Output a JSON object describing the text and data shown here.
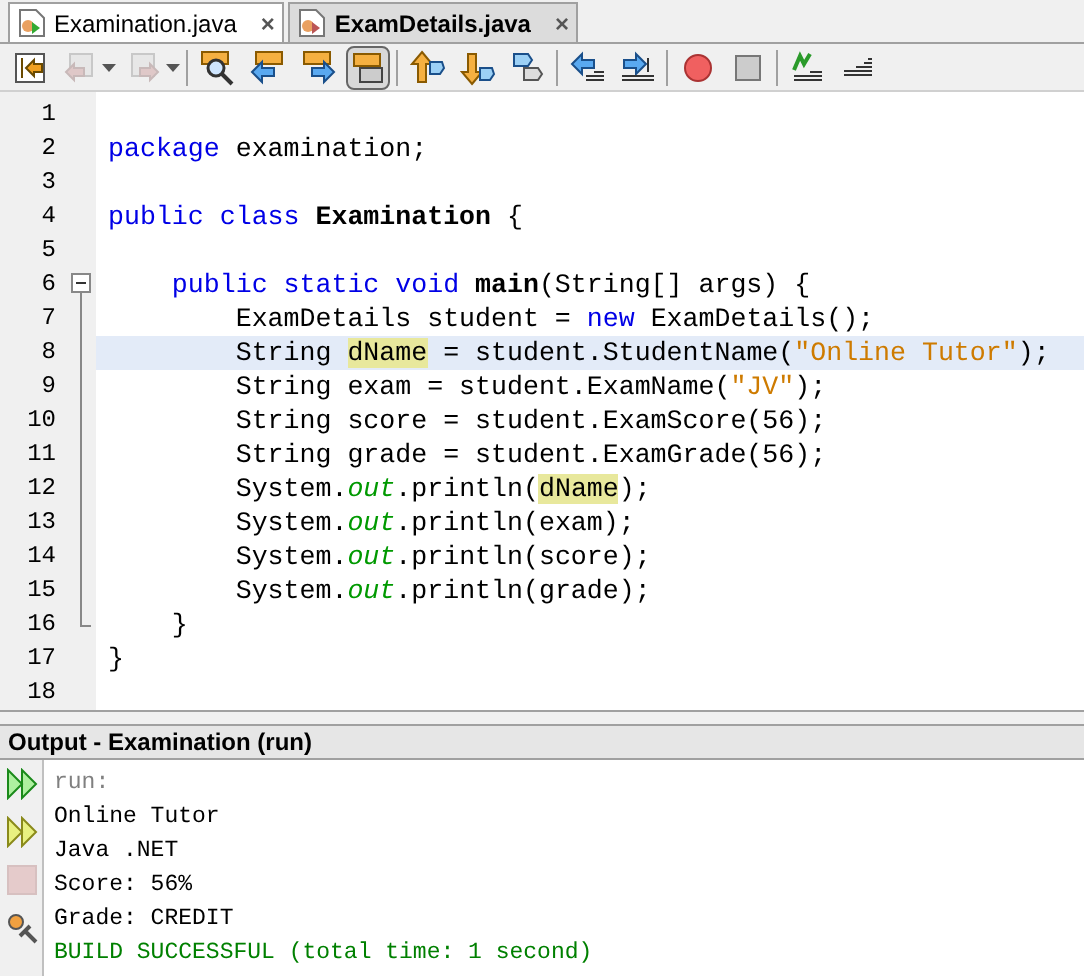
{
  "tabs": [
    {
      "label": "Examination.java",
      "selected": true,
      "modified": false,
      "close": "×"
    },
    {
      "label": "ExamDetails.java",
      "selected": false,
      "modified": true,
      "close": "×"
    }
  ],
  "toolbar": [
    {
      "kind": "jump",
      "disabled": false,
      "pressed": false
    },
    {
      "kind": "back",
      "disabled": true,
      "pressed": false
    },
    {
      "kind": "forward",
      "disabled": true,
      "pressed": false
    },
    {
      "kind": "find",
      "disabled": false,
      "pressed": false
    },
    {
      "kind": "prev",
      "disabled": false,
      "pressed": false
    },
    {
      "kind": "next",
      "disabled": false,
      "pressed": false
    },
    {
      "kind": "highlight",
      "disabled": false,
      "pressed": true
    },
    {
      "kind": "up",
      "disabled": false,
      "pressed": false
    },
    {
      "kind": "down",
      "disabled": false,
      "pressed": false
    },
    {
      "kind": "tag",
      "disabled": false,
      "pressed": false
    },
    {
      "kind": "shift-left",
      "disabled": false,
      "pressed": false
    },
    {
      "kind": "shift-right",
      "disabled": false,
      "pressed": false
    },
    {
      "kind": "record",
      "disabled": false,
      "pressed": false
    },
    {
      "kind": "stop",
      "disabled": false,
      "pressed": false
    },
    {
      "kind": "comment",
      "disabled": false,
      "pressed": false
    },
    {
      "kind": "uncomment",
      "disabled": false,
      "pressed": false
    }
  ],
  "editor": {
    "lines": [
      {
        "number": "1",
        "current": false
      },
      {
        "number": "2",
        "current": false,
        "segments": [
          {
            "kind": "kw",
            "text": "package"
          },
          {
            "kind": "plain",
            "text": " examination;"
          }
        ]
      },
      {
        "number": "3",
        "current": false
      },
      {
        "number": "4",
        "current": false,
        "segments": [
          {
            "kind": "kw",
            "text": "public class "
          },
          {
            "kind": "bold",
            "text": "Examination"
          },
          {
            "kind": "plain",
            "text": " {"
          }
        ]
      },
      {
        "number": "5",
        "current": false
      },
      {
        "number": "6",
        "current": false,
        "fold": {
          "kind": "start"
        },
        "segments": [
          {
            "kind": "kw",
            "text": "    public static void "
          },
          {
            "kind": "bold",
            "text": "main"
          },
          {
            "kind": "plain",
            "text": "(String[] args) {"
          }
        ]
      },
      {
        "number": "7",
        "current": false,
        "fold": {
          "kind": "line"
        },
        "segments": [
          {
            "kind": "plain",
            "text": "        ExamDetails student = "
          },
          {
            "kind": "kw",
            "text": "new"
          },
          {
            "kind": "plain",
            "text": " ExamDetails();"
          }
        ]
      },
      {
        "number": "8",
        "current": true,
        "fold": {
          "kind": "line"
        },
        "segments": [
          {
            "kind": "plain",
            "text": "        String "
          },
          {
            "kind": "mark",
            "text": "dName"
          },
          {
            "kind": "plain",
            "text": " = student.StudentName("
          },
          {
            "kind": "str",
            "text": "\"Online Tutor\""
          },
          {
            "kind": "plain",
            "text": ");"
          }
        ]
      },
      {
        "number": "9",
        "current": false,
        "fold": {
          "kind": "line"
        },
        "segments": [
          {
            "kind": "plain",
            "text": "        String exam = student.ExamName("
          },
          {
            "kind": "str",
            "text": "\"JV\""
          },
          {
            "kind": "plain",
            "text": ");"
          }
        ]
      },
      {
        "number": "10",
        "current": false,
        "fold": {
          "kind": "line"
        },
        "segments": [
          {
            "kind": "plain",
            "text": "        String score = student.ExamScore(56);"
          }
        ]
      },
      {
        "number": "11",
        "current": false,
        "fold": {
          "kind": "line"
        },
        "segments": [
          {
            "kind": "plain",
            "text": "        String grade = student.ExamGrade(56);"
          }
        ]
      },
      {
        "number": "12",
        "current": false,
        "fold": {
          "kind": "line"
        },
        "segments": [
          {
            "kind": "plain",
            "text": "        System."
          },
          {
            "kind": "field",
            "text": "out"
          },
          {
            "kind": "plain",
            "text": ".println("
          },
          {
            "kind": "mark",
            "text": "dName"
          },
          {
            "kind": "plain",
            "text": ");"
          }
        ]
      },
      {
        "number": "13",
        "current": false,
        "fold": {
          "kind": "line"
        },
        "segments": [
          {
            "kind": "plain",
            "text": "        System."
          },
          {
            "kind": "field",
            "text": "out"
          },
          {
            "kind": "plain",
            "text": ".println(exam);"
          }
        ]
      },
      {
        "number": "14",
        "current": false,
        "fold": {
          "kind": "line"
        },
        "segments": [
          {
            "kind": "plain",
            "text": "        System."
          },
          {
            "kind": "field",
            "text": "out"
          },
          {
            "kind": "plain",
            "text": ".println(score);"
          }
        ]
      },
      {
        "number": "15",
        "current": false,
        "fold": {
          "kind": "line"
        },
        "segments": [
          {
            "kind": "plain",
            "text": "        System."
          },
          {
            "kind": "field",
            "text": "out"
          },
          {
            "kind": "plain",
            "text": ".println(grade);"
          }
        ]
      },
      {
        "number": "16",
        "current": false,
        "fold": {
          "kind": "end"
        },
        "segments": [
          {
            "kind": "plain",
            "text": "    }"
          }
        ]
      },
      {
        "number": "17",
        "current": false,
        "segments": [
          {
            "kind": "plain",
            "text": "}"
          }
        ]
      },
      {
        "number": "18",
        "current": false
      }
    ]
  },
  "output": {
    "title": "Output - Examination (run)",
    "actions": [
      {
        "kind": "rerun",
        "disabled": false
      },
      {
        "kind": "rerun-options",
        "disabled": false
      },
      {
        "kind": "stop",
        "disabled": true
      },
      {
        "kind": "settings",
        "disabled": false
      }
    ],
    "lines": [
      {
        "kind": "muted",
        "text": "run:"
      },
      {
        "kind": "normal",
        "text": "Online Tutor"
      },
      {
        "kind": "normal",
        "text": "Java .NET"
      },
      {
        "kind": "normal",
        "text": "Score: 56%"
      },
      {
        "kind": "normal",
        "text": "Grade: CREDIT"
      },
      {
        "kind": "success",
        "text": "BUILD SUCCESSFUL (total time: 1 second)"
      }
    ]
  }
}
